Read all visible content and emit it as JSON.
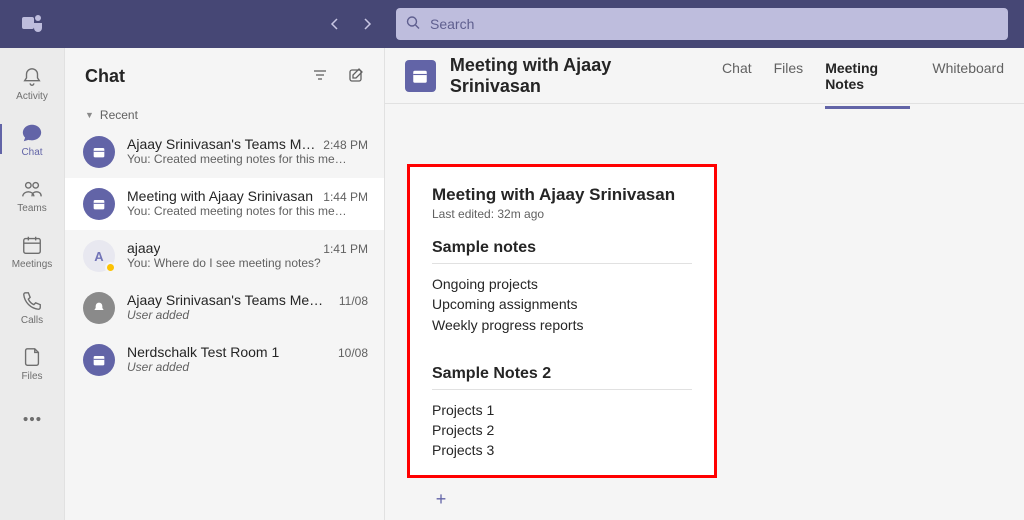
{
  "search": {
    "placeholder": "Search"
  },
  "apprail": [
    {
      "id": "activity",
      "label": "Activity"
    },
    {
      "id": "chat",
      "label": "Chat"
    },
    {
      "id": "teams",
      "label": "Teams"
    },
    {
      "id": "meetings",
      "label": "Meetings"
    },
    {
      "id": "calls",
      "label": "Calls"
    },
    {
      "id": "files",
      "label": "Files"
    }
  ],
  "chatHeader": {
    "title": "Chat"
  },
  "sectionLabel": "Recent",
  "chats": [
    {
      "title": "Ajaay Srinivasan's Teams Mee…",
      "time": "2:48 PM",
      "preview": "You: Created meeting notes for this me…",
      "avatar": "cal"
    },
    {
      "title": "Meeting with Ajaay Srinivasan",
      "time": "1:44 PM",
      "preview": "You: Created meeting notes for this me…",
      "avatar": "cal",
      "selected": true
    },
    {
      "title": "ajaay",
      "time": "1:41 PM",
      "preview": "You: Where do I see meeting notes?",
      "avatar": "person",
      "initial": "A"
    },
    {
      "title": "Ajaay Srinivasan's Teams Meeting",
      "time": "11/08",
      "preview": "User added",
      "avatar": "grey",
      "italic": true
    },
    {
      "title": "Nerdschalk Test Room 1",
      "time": "10/08",
      "preview": "User added",
      "avatar": "cal",
      "italic": true
    }
  ],
  "content": {
    "title": "Meeting with Ajaay Srinivasan",
    "tabs": [
      {
        "label": "Chat"
      },
      {
        "label": "Files"
      },
      {
        "label": "Meeting Notes",
        "active": true
      },
      {
        "label": "Whiteboard"
      }
    ],
    "notes": {
      "heading": "Meeting with Ajaay Srinivasan",
      "edited": "Last edited: 32m ago",
      "section1": {
        "title": "Sample notes",
        "lines": [
          "Ongoing projects",
          "Upcoming assignments",
          "Weekly progress reports"
        ]
      },
      "section2": {
        "title": "Sample Notes 2",
        "lines": [
          "Projects 1",
          "Projects 2",
          "Projects 3"
        ]
      }
    }
  }
}
